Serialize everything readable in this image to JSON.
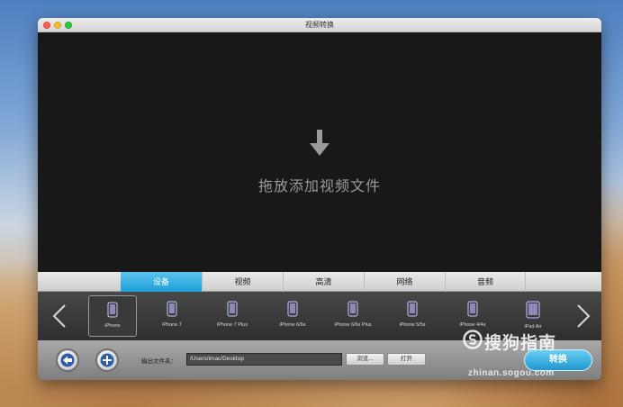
{
  "window": {
    "title": "视频转换"
  },
  "dropzone": {
    "text": "拖放添加视频文件",
    "icon": "down-arrow-icon"
  },
  "tabs": [
    {
      "label": "设备",
      "active": true
    },
    {
      "label": "视频",
      "active": false
    },
    {
      "label": "高清",
      "active": false
    },
    {
      "label": "网络",
      "active": false
    },
    {
      "label": "音频",
      "active": false
    }
  ],
  "devices": [
    {
      "label": "iPhone",
      "selected": true
    },
    {
      "label": "iPhone 7"
    },
    {
      "label": "iPhone 7 Plus"
    },
    {
      "label": "iPhone 6/6s"
    },
    {
      "label": "iPhone 6/6s Plus"
    },
    {
      "label": "iPhone 5/5s"
    },
    {
      "label": "iPhone 4/4s"
    },
    {
      "label": "iPad Air"
    }
  ],
  "bottom": {
    "output_label": "输出文件夹：",
    "output_path": "/Users/imac/Desktop",
    "browse_label": "浏览...",
    "open_label": "打开",
    "convert_label": "转换"
  },
  "watermark": {
    "text": "搜狗指南",
    "url": "zhinan.sogou.com"
  },
  "colors": {
    "accent": "#1c9fd8",
    "background": "#181818"
  }
}
